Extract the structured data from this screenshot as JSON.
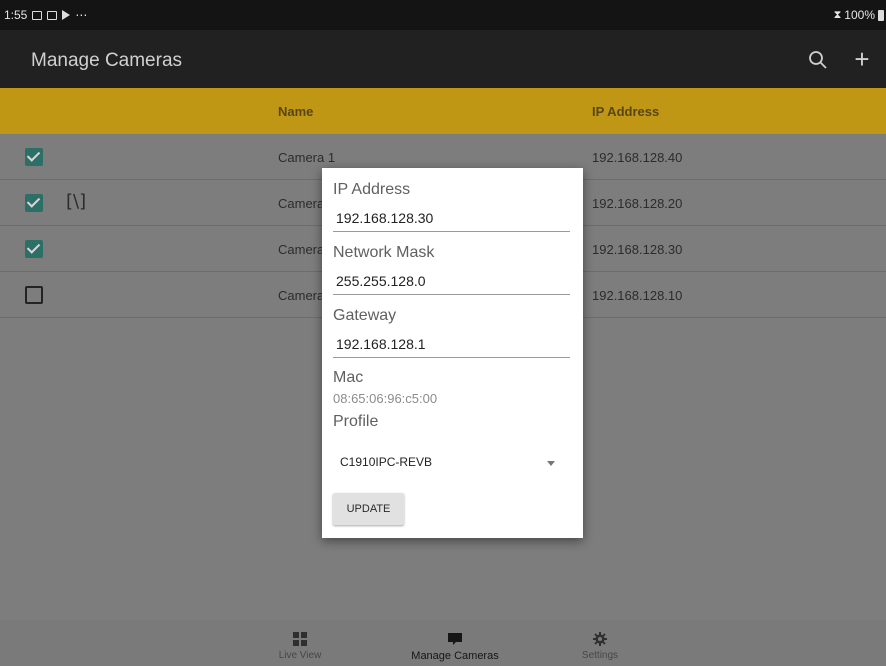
{
  "status_bar": {
    "time": "1:55",
    "more": "⋯",
    "battery": "100%"
  },
  "app_bar": {
    "title": "Manage Cameras"
  },
  "table": {
    "columns": [
      "Name",
      "IP Address"
    ],
    "rows": [
      {
        "name": "Camera 1",
        "ip": "192.168.128.40",
        "checked": true
      },
      {
        "name": "Camera",
        "ip": "192.168.128.20",
        "checked": true
      },
      {
        "name": "Camera",
        "ip": "192.168.128.30",
        "checked": true
      },
      {
        "name": "Camera",
        "ip": "192.168.128.10",
        "checked": false
      }
    ],
    "row2_glyph": "[\\]"
  },
  "dialog": {
    "ip_label": "IP Address",
    "ip_value": "192.168.128.30",
    "mask_label": "Network Mask",
    "mask_value": "255.255.128.0",
    "gateway_label": "Gateway",
    "gateway_value": "192.168.128.1",
    "mac_label": "Mac",
    "mac_value": "08:65:06:96:c5:00",
    "profile_label": "Profile",
    "profile_value": "C1910IPC-REVB",
    "update_button": "UPDATE"
  },
  "bottom_nav": [
    {
      "label": "Live View",
      "icon": "grid-icon",
      "active": false
    },
    {
      "label": "Manage Cameras",
      "icon": "camera-icon",
      "active": true
    },
    {
      "label": "Settings",
      "icon": "gear-icon",
      "active": false
    }
  ],
  "colors": {
    "header": "#bf9714",
    "app_bar": "#212121",
    "checkbox_checked": "#2b6f67",
    "scrim_content": "#7d7d7d"
  }
}
